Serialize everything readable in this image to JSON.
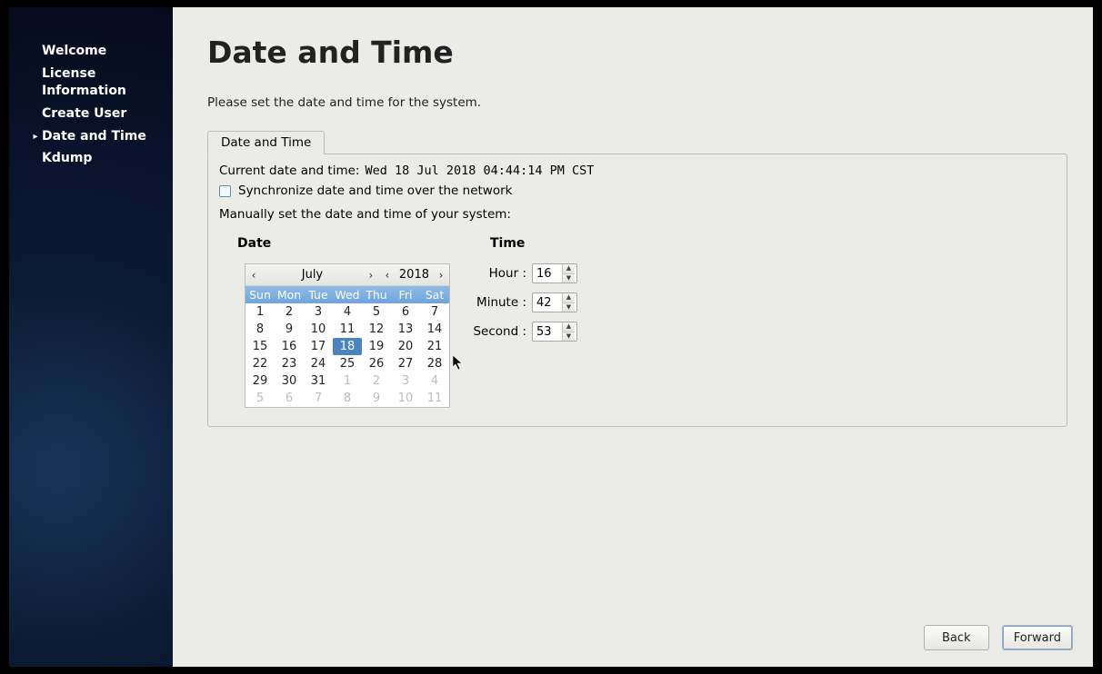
{
  "sidebar": {
    "items": [
      {
        "label": "Welcome"
      },
      {
        "label": "License Information"
      },
      {
        "label": "Create User"
      },
      {
        "label": "Date and Time"
      },
      {
        "label": "Kdump"
      }
    ],
    "active_index": 3
  },
  "page": {
    "title": "Date and Time",
    "intro": "Please set the date and time for the system.",
    "tab_label": "Date and Time",
    "current_label": "Current date and time:",
    "current_value": "Wed 18 Jul 2018 04:44:14 PM CST",
    "sync_label": "Synchronize date and time over the network",
    "sync_checked": false,
    "manual_label": "Manually set the date and time of your system:",
    "date_heading": "Date",
    "time_heading": "Time"
  },
  "calendar": {
    "month_label": "July",
    "year_label": "2018",
    "dow": [
      "Sun",
      "Mon",
      "Tue",
      "Wed",
      "Thu",
      "Fri",
      "Sat"
    ],
    "selected_day": 18,
    "weeks": [
      [
        {
          "n": 1
        },
        {
          "n": 2
        },
        {
          "n": 3
        },
        {
          "n": 4
        },
        {
          "n": 5
        },
        {
          "n": 6
        },
        {
          "n": 7
        }
      ],
      [
        {
          "n": 8
        },
        {
          "n": 9
        },
        {
          "n": 10
        },
        {
          "n": 11
        },
        {
          "n": 12
        },
        {
          "n": 13
        },
        {
          "n": 14
        }
      ],
      [
        {
          "n": 15
        },
        {
          "n": 16
        },
        {
          "n": 17
        },
        {
          "n": 18,
          "sel": true
        },
        {
          "n": 19
        },
        {
          "n": 20
        },
        {
          "n": 21
        }
      ],
      [
        {
          "n": 22
        },
        {
          "n": 23
        },
        {
          "n": 24
        },
        {
          "n": 25
        },
        {
          "n": 26
        },
        {
          "n": 27
        },
        {
          "n": 28
        }
      ],
      [
        {
          "n": 29
        },
        {
          "n": 30
        },
        {
          "n": 31
        },
        {
          "n": 1,
          "other": true
        },
        {
          "n": 2,
          "other": true
        },
        {
          "n": 3,
          "other": true
        },
        {
          "n": 4,
          "other": true
        }
      ],
      [
        {
          "n": 5,
          "other": true
        },
        {
          "n": 6,
          "other": true
        },
        {
          "n": 7,
          "other": true
        },
        {
          "n": 8,
          "other": true
        },
        {
          "n": 9,
          "other": true
        },
        {
          "n": 10,
          "other": true
        },
        {
          "n": 11,
          "other": true
        }
      ]
    ]
  },
  "time": {
    "hour_label": "Hour :",
    "minute_label": "Minute :",
    "second_label": "Second :",
    "hour": "16",
    "minute": "42",
    "second": "53"
  },
  "footer": {
    "back": "Back",
    "forward": "Forward"
  }
}
